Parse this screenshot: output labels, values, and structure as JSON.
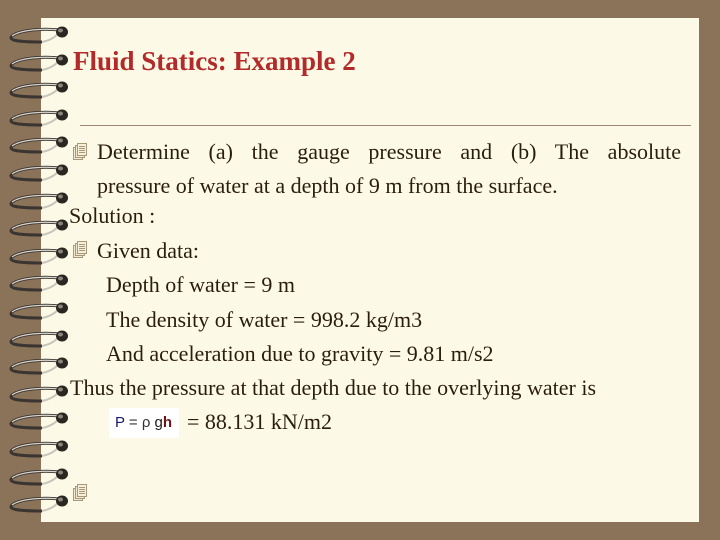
{
  "slide": {
    "title": "Fluid Statics: Example 2",
    "colors": {
      "background": "#8b735a",
      "paper": "#fcfae6",
      "title": "#b22a2a",
      "text": "#2b1d0c"
    },
    "bullet_icon": "stacked-pages-icon",
    "binding_icon": "spiral-ring-icon",
    "content": {
      "question_line1": "Determine (a) the gauge pressure and (b) The absolute",
      "question_line2": "pressure of water at a depth of 9 m from the surface.",
      "solution_label": "Solution :",
      "given_label": "Given data:",
      "given_items": [
        "Depth of water = 9 m",
        "The density of water = 998.2 kg/m3",
        "And acceleration due to gravity = 9.81 m/s2"
      ],
      "conclusion": "Thus the pressure at that depth due to the overlying water is",
      "formula": {
        "p": "P",
        "eq": " = ",
        "rho": "ρ",
        "g": " g",
        "h": "h"
      },
      "result": "= 88.131 kN/m2"
    }
  }
}
